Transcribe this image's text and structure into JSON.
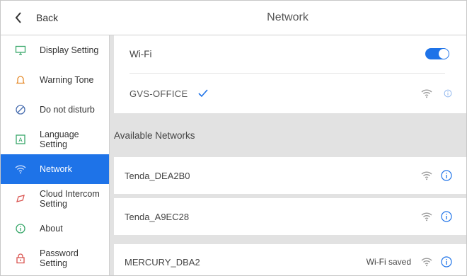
{
  "header": {
    "back_label": "Back",
    "title": "Network"
  },
  "sidebar": {
    "items": [
      {
        "label": "Display Setting",
        "icon": "monitor-icon",
        "active": false
      },
      {
        "label": "Warning Tone",
        "icon": "bell-icon",
        "active": false
      },
      {
        "label": "Do not disturb",
        "icon": "do-not-disturb-icon",
        "active": false
      },
      {
        "label": "Language Setting",
        "icon": "language-icon",
        "active": false
      },
      {
        "label": "Network",
        "icon": "wifi-icon",
        "active": true
      },
      {
        "label": "Cloud Intercom Setting",
        "icon": "cloud-icon",
        "active": false
      },
      {
        "label": "About",
        "icon": "info-icon",
        "active": false
      },
      {
        "label": "Password Setting",
        "icon": "lock-icon",
        "active": false
      }
    ]
  },
  "wifi": {
    "label": "Wi-Fi",
    "enabled": true,
    "connected_ssid": "GVS-OFFICE"
  },
  "available": {
    "header": "Available Networks",
    "networks": [
      {
        "ssid": "Tenda_DEA2B0",
        "status": ""
      },
      {
        "ssid": "Tenda_A9EC28",
        "status": ""
      },
      {
        "ssid": "MERCURY_DBA2",
        "status": "Wi-Fi saved"
      }
    ]
  },
  "colors": {
    "accent": "#1e73e8",
    "panel_bg": "#e2e2e2"
  }
}
